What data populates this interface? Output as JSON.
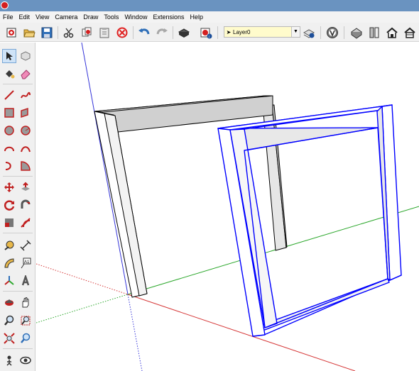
{
  "window": {
    "app_icon": "sketchup-logo-icon"
  },
  "menu": [
    "File",
    "Edit",
    "View",
    "Camera",
    "Draw",
    "Tools",
    "Window",
    "Extensions",
    "Help"
  ],
  "toolbar": {
    "layer_value": "Layer0",
    "icons": [
      "new-file-icon",
      "open-folder-icon",
      "save-icon",
      "cut-icon",
      "copy-icon",
      "paste-icon",
      "erase-icon",
      "undo-icon",
      "redo-icon",
      "print-icon",
      "model-info-icon",
      "layer-arrow-icon",
      "layer-manager-icon",
      "extension-warehouse-icon",
      "3d-warehouse-icon",
      "components-icon",
      "home-icon",
      "house-icon"
    ]
  },
  "tools": [
    "select-icon",
    "component-icon",
    "paint-bucket-icon",
    "eraser-icon",
    "line-icon",
    "freehand-icon",
    "rectangle-icon",
    "rotated-rectangle-icon",
    "circle-icon",
    "polygon-icon",
    "arc-icon",
    "two-point-arc-icon",
    "three-point-arc-icon",
    "pie-icon",
    "move-icon",
    "push-pull-icon",
    "rotate-icon",
    "follow-me-icon",
    "scale-icon",
    "offset-icon",
    "tape-measure-icon",
    "dimension-icon",
    "protractor-icon",
    "text-icon",
    "axes-icon",
    "3d-text-icon",
    "orbit-icon",
    "pan-icon",
    "zoom-icon",
    "zoom-window-icon",
    "zoom-extents-icon",
    "previous-view-icon",
    "position-camera-icon",
    "look-around-icon"
  ],
  "colors": {
    "red_axis": "#d63a3a",
    "green_axis": "#2da82d",
    "blue_axis": "#3434d8",
    "selection": "#0000ff"
  }
}
